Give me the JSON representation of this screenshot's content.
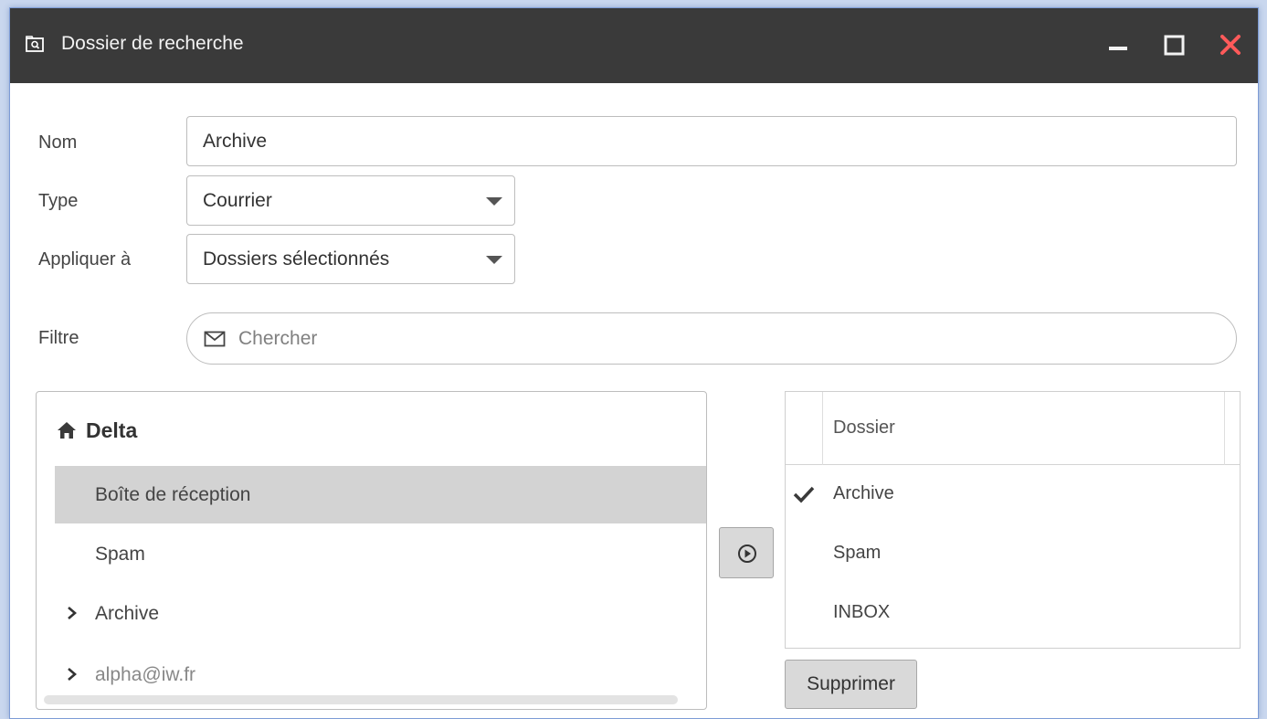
{
  "window": {
    "title": "Dossier de recherche",
    "icon": "search-folder-icon",
    "controls": [
      "minimize-icon",
      "maximize-icon",
      "close-icon"
    ],
    "close_color": "#ff5a5a"
  },
  "form": {
    "name_label": "Nom",
    "name_value": "Archive",
    "type_label": "Type",
    "type_value": "Courrier",
    "apply_label": "Appliquer à",
    "apply_value": "Dossiers sélectionnés",
    "filter_label": "Filtre",
    "filter_placeholder": "Chercher",
    "filter_icon": "envelope-icon"
  },
  "tree": {
    "root_icon": "home-icon",
    "root_label": "Delta",
    "items": [
      {
        "label": "Boîte de réception",
        "selected": true,
        "expandable": false
      },
      {
        "label": "Spam",
        "selected": false,
        "expandable": false
      },
      {
        "label": "Archive",
        "selected": false,
        "expandable": true
      },
      {
        "label": "alpha@iw.fr",
        "selected": false,
        "expandable": true
      }
    ]
  },
  "move_button_icon": "play-circle-icon",
  "selected_folders": {
    "header": "Dossier",
    "rows": [
      {
        "label": "Archive",
        "checked": true
      },
      {
        "label": "Spam",
        "checked": false
      },
      {
        "label": "INBOX",
        "checked": false
      }
    ]
  },
  "delete_button": "Supprimer"
}
